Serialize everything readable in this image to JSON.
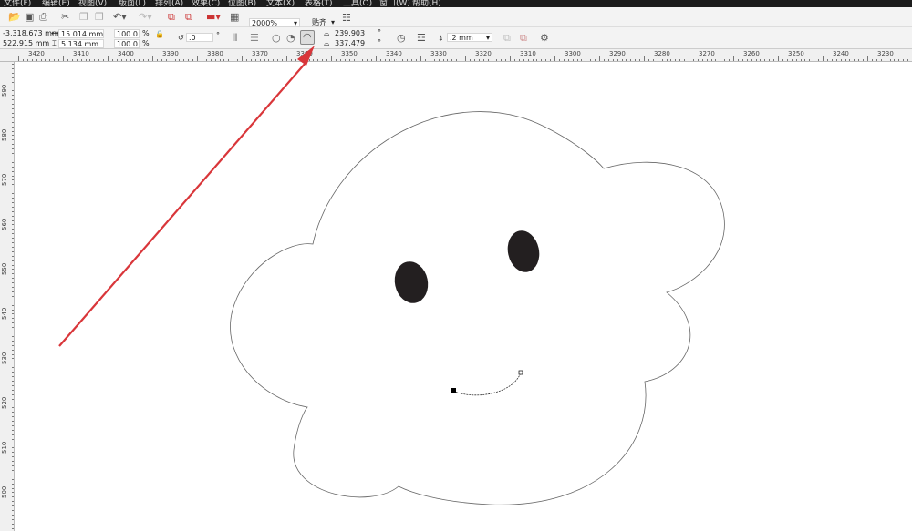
{
  "menu": [
    "文件(F)",
    "编辑(E)",
    "视图(V)",
    "版面(L)",
    "排列(A)",
    "效果(C)",
    "位图(B)",
    "文本(X)",
    "表格(T)",
    "工具(O)",
    "窗口(W)",
    "帮助(H)"
  ],
  "toolbar": {
    "zoom": "2000%",
    "snap": "贴齐"
  },
  "props": {
    "x": "-3,318.673 mm",
    "y": "522.915 mm",
    "width": "15.014 mm",
    "height": "5.134 mm",
    "scale_x": "100.0",
    "scale_y": "100.0",
    "pct": "%",
    "rotation": ".0",
    "deg": "°",
    "start_angle": "239.903",
    "end_angle": "337.479",
    "outline": ".2 mm"
  },
  "rulers": {
    "h": [
      "3420",
      "3410",
      "3400",
      "3390",
      "3380",
      "3370",
      "3360",
      "3350",
      "3340",
      "3330",
      "3320",
      "3310",
      "3300",
      "3290",
      "3280",
      "3270",
      "3260",
      "3250",
      "3240",
      "3230"
    ],
    "v": [
      "590",
      "580",
      "570",
      "560",
      "550",
      "540",
      "530",
      "520",
      "510",
      "500"
    ]
  },
  "colors": {
    "arrow": "#d9363a",
    "outline": "#555555",
    "fill": "#231f20"
  }
}
